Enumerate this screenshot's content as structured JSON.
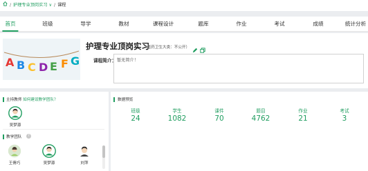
{
  "breadcrumb": {
    "separator": "/",
    "course_link": "护理专业顶岗实习",
    "dropdown_glyph": "∨",
    "current": "课程"
  },
  "nav": {
    "tabs": [
      {
        "label": "首页",
        "active": true
      },
      {
        "label": "班级",
        "active": false
      },
      {
        "label": "导学",
        "active": false
      },
      {
        "label": "教材",
        "active": false
      },
      {
        "label": "课程设计",
        "active": false
      },
      {
        "label": "题库",
        "active": false
      },
      {
        "label": "作业",
        "active": false
      },
      {
        "label": "考试",
        "active": false
      },
      {
        "label": "成绩",
        "active": false
      },
      {
        "label": "统计分析",
        "active": false
      }
    ]
  },
  "course": {
    "title": "护理专业顶岗实习",
    "subtitle": "（墨药卫生大类：不公开）",
    "cover_letters": [
      "A",
      "B",
      "C",
      "D",
      "E",
      "F",
      "G"
    ],
    "intro_label": "课程简介：",
    "intro_text": "暂无简介！"
  },
  "host": {
    "label": "主持教师",
    "link": "如何建设教学团队？",
    "name": "吴梦源"
  },
  "team": {
    "label": "教学团队",
    "help": "?",
    "members": [
      {
        "name": "王倩巧"
      },
      {
        "name": "吴梦源"
      },
      {
        "name": "刘萍"
      }
    ]
  },
  "overview": {
    "title": "数据预览",
    "stats": [
      {
        "label": "班级",
        "value": "24"
      },
      {
        "label": "学生",
        "value": "1082"
      },
      {
        "label": "课件",
        "value": "70"
      },
      {
        "label": "题目",
        "value": "4762"
      },
      {
        "label": "作业",
        "value": "21"
      },
      {
        "label": "考试",
        "value": "3"
      }
    ]
  },
  "colors": {
    "accent": "#1f9d5f",
    "background": "#ebedf0",
    "panel": "#ffffff"
  },
  "icons": {
    "home": "home-icon",
    "edit": "edit-icon",
    "copy": "copy-icon",
    "help": "help-icon"
  }
}
